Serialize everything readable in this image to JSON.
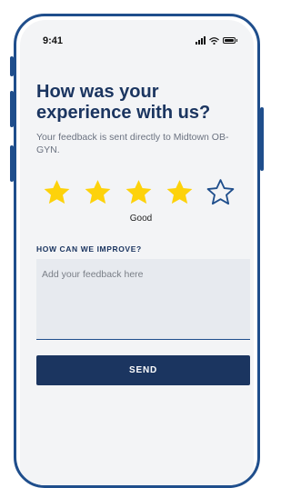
{
  "status_bar": {
    "time": "9:41"
  },
  "feedback": {
    "title": "How was your experience with us?",
    "subtitle": "Your feedback is sent directly to Midtown OB-GYN.",
    "rating": {
      "value": 4,
      "max": 5,
      "label": "Good"
    },
    "improve_label": "HOW CAN WE IMPROVE?",
    "input_placeholder": "Add your feedback here",
    "input_value": "",
    "send_label": "SEND"
  },
  "colors": {
    "brand_navy": "#1b3560",
    "frame_blue": "#1f4e8c",
    "star_filled": "#fdd20b",
    "star_empty_outline": "#1f4e8c",
    "screen_bg": "#f3f4f6",
    "input_bg": "#e7eaef"
  },
  "icons": {
    "star_filled": "star-filled-icon",
    "star_empty": "star-outline-icon",
    "signal": "signal-icon",
    "wifi": "wifi-icon",
    "battery": "battery-icon"
  }
}
